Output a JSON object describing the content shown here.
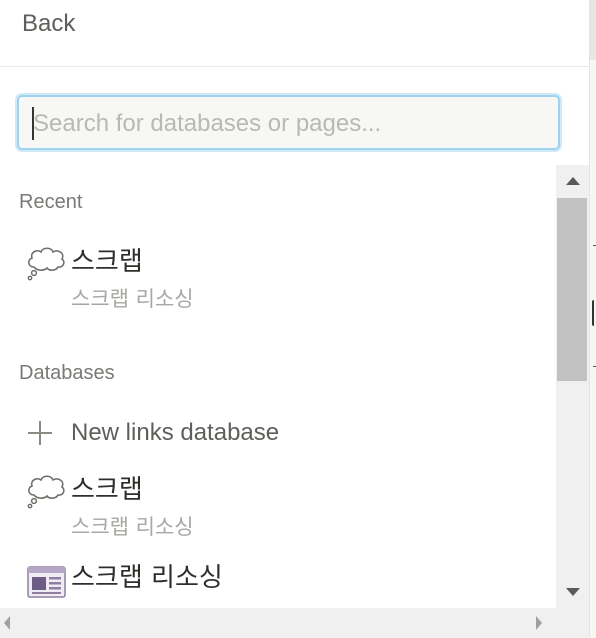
{
  "header": {
    "back_label": "Back"
  },
  "search": {
    "placeholder": "Search for databases or pages...",
    "value": ""
  },
  "sections": {
    "recent": {
      "title": "Recent",
      "items": [
        {
          "icon": "thought-bubble-icon",
          "title": "스크랩",
          "subtitle": "스크랩 리소싱"
        }
      ]
    },
    "databases": {
      "title": "Databases",
      "new_link_label": "New links database",
      "items": [
        {
          "icon": "thought-bubble-icon",
          "title": "스크랩",
          "subtitle": "스크랩 리소싱"
        },
        {
          "icon": "newspaper-icon",
          "title": "스크랩 리소싱"
        }
      ]
    }
  },
  "colors": {
    "focus_ring": "#9ed3ef",
    "text": "#37352f",
    "muted": "#a8a7a3",
    "scrollbar_thumb": "#c2c2c2"
  }
}
